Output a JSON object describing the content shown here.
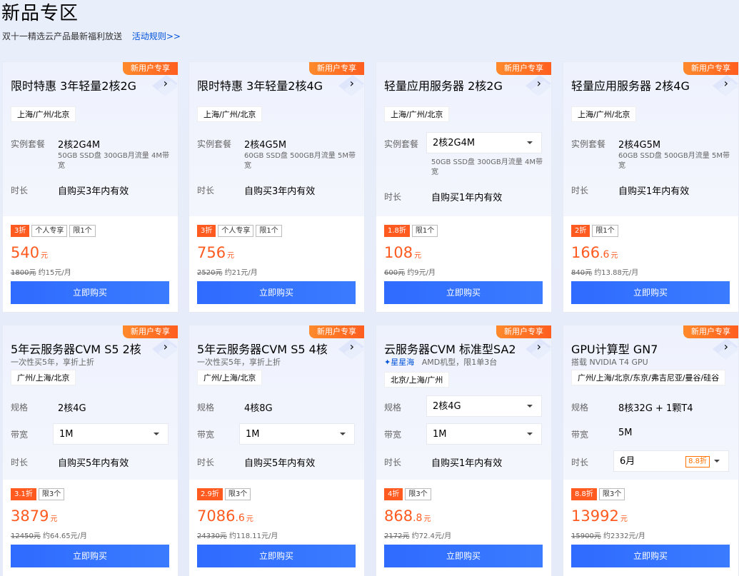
{
  "header": {
    "title": "新品专区",
    "subtitle": "双十一精选云产品最新福利放送",
    "rules_link": "活动规则>>"
  },
  "ribbon": "新用户专享",
  "buy_label": "立即购买",
  "cards": [
    {
      "title": "限时特惠 3年轻量2核2G",
      "region": "上海/广州/北京",
      "spec_label": "实例套餐",
      "spec_value": "2核2G4M",
      "spec_desc": "50GB SSD盘 300GB月流量 4M带宽",
      "duration_label": "时长",
      "duration_value": "自购买3年内有效",
      "tags": [
        "3折",
        "个人专享",
        "限1个"
      ],
      "price_int": "540",
      "price_dec": "",
      "price_unit": "元",
      "orig_price": "1800元",
      "monthly": "约15元/月"
    },
    {
      "title": "限时特惠 3年轻量2核4G",
      "region": "上海/广州/北京",
      "spec_label": "实例套餐",
      "spec_value": "2核4G5M",
      "spec_desc": "60GB SSD盘 500GB月流量 5M带宽",
      "duration_label": "时长",
      "duration_value": "自购买3年内有效",
      "tags": [
        "3折",
        "个人专享",
        "限1个"
      ],
      "price_int": "756",
      "price_dec": "",
      "price_unit": "元",
      "orig_price": "2520元",
      "monthly": "约21元/月"
    },
    {
      "title": "轻量应用服务器 2核2G",
      "region": "上海/广州/北京",
      "spec_label": "实例套餐",
      "spec_value": "2核2G4M",
      "spec_desc": "50GB SSD盘 300GB月流量 4M带宽",
      "duration_label": "时长",
      "duration_value": "自购买1年内有效",
      "tags": [
        "1.8折",
        "限1个"
      ],
      "price_int": "108",
      "price_dec": "",
      "price_unit": "元",
      "orig_price": "600元",
      "monthly": "约9元/月"
    },
    {
      "title": "轻量应用服务器 2核4G",
      "region": "上海/广州/北京",
      "spec_label": "实例套餐",
      "spec_value": "2核4G5M",
      "spec_desc": "60GB SSD盘 500GB月流量 5M带宽",
      "duration_label": "时长",
      "duration_value": "自购买1年内有效",
      "tags": [
        "2折",
        "限1个"
      ],
      "price_int": "166",
      "price_dec": ".6",
      "price_unit": "元",
      "orig_price": "840元",
      "monthly": "约13.88元/月"
    },
    {
      "title": "5年云服务器CVM S5 2核",
      "subtitle": "一次性买5年，享折上折",
      "region": "广州/上海/北京",
      "spec_label": "规格",
      "spec_value": "2核4G",
      "bw_label": "带宽",
      "bw_value": "1M",
      "duration_label": "时长",
      "duration_value": "自购买5年内有效",
      "tags": [
        "3.1折",
        "限3个"
      ],
      "price_int": "3879",
      "price_dec": "",
      "price_unit": "元",
      "orig_price": "12450元",
      "monthly": "约64.65元/月"
    },
    {
      "title": "5年云服务器CVM S5 4核",
      "subtitle": "一次性买5年，享折上折",
      "region": "广州/上海/北京",
      "spec_label": "规格",
      "spec_value": "4核8G",
      "bw_label": "带宽",
      "bw_value": "1M",
      "duration_label": "时长",
      "duration_value": "自购买5年内有效",
      "tags": [
        "2.9折",
        "限3个"
      ],
      "price_int": "7086",
      "price_dec": ".6",
      "price_unit": "元",
      "orig_price": "24330元",
      "monthly": "约118.11元/月"
    },
    {
      "title": "云服务器CVM 标准型SA2",
      "brand": "星星海",
      "subtitle": "AMD机型，限1单3台",
      "region": "北京/上海/广州",
      "spec_label": "规格",
      "spec_value": "2核4G",
      "bw_label": "带宽",
      "bw_value": "1M",
      "duration_label": "时长",
      "duration_value": "自购买1年内有效",
      "tags": [
        "4折",
        "限3个"
      ],
      "price_int": "868",
      "price_dec": ".8",
      "price_unit": "元",
      "orig_price": "2172元",
      "monthly": "约72.4元/月"
    },
    {
      "title": "GPU计算型 GN7",
      "subtitle": "搭载 NVIDIA T4 GPU",
      "region": "广州/上海/北京/东京/弗吉尼亚/曼谷/硅谷",
      "spec_label": "规格",
      "spec_value": "8核32G + 1颗T4",
      "bw_label": "带宽",
      "bw_value": "5M",
      "duration_label": "时长",
      "duration_value": "6月",
      "duration_discount": "8.8折",
      "tags": [
        "8.8折",
        "限3个"
      ],
      "price_int": "13992",
      "price_dec": "",
      "price_unit": "元",
      "orig_price": "15900元",
      "monthly": "约2332元/月"
    }
  ]
}
